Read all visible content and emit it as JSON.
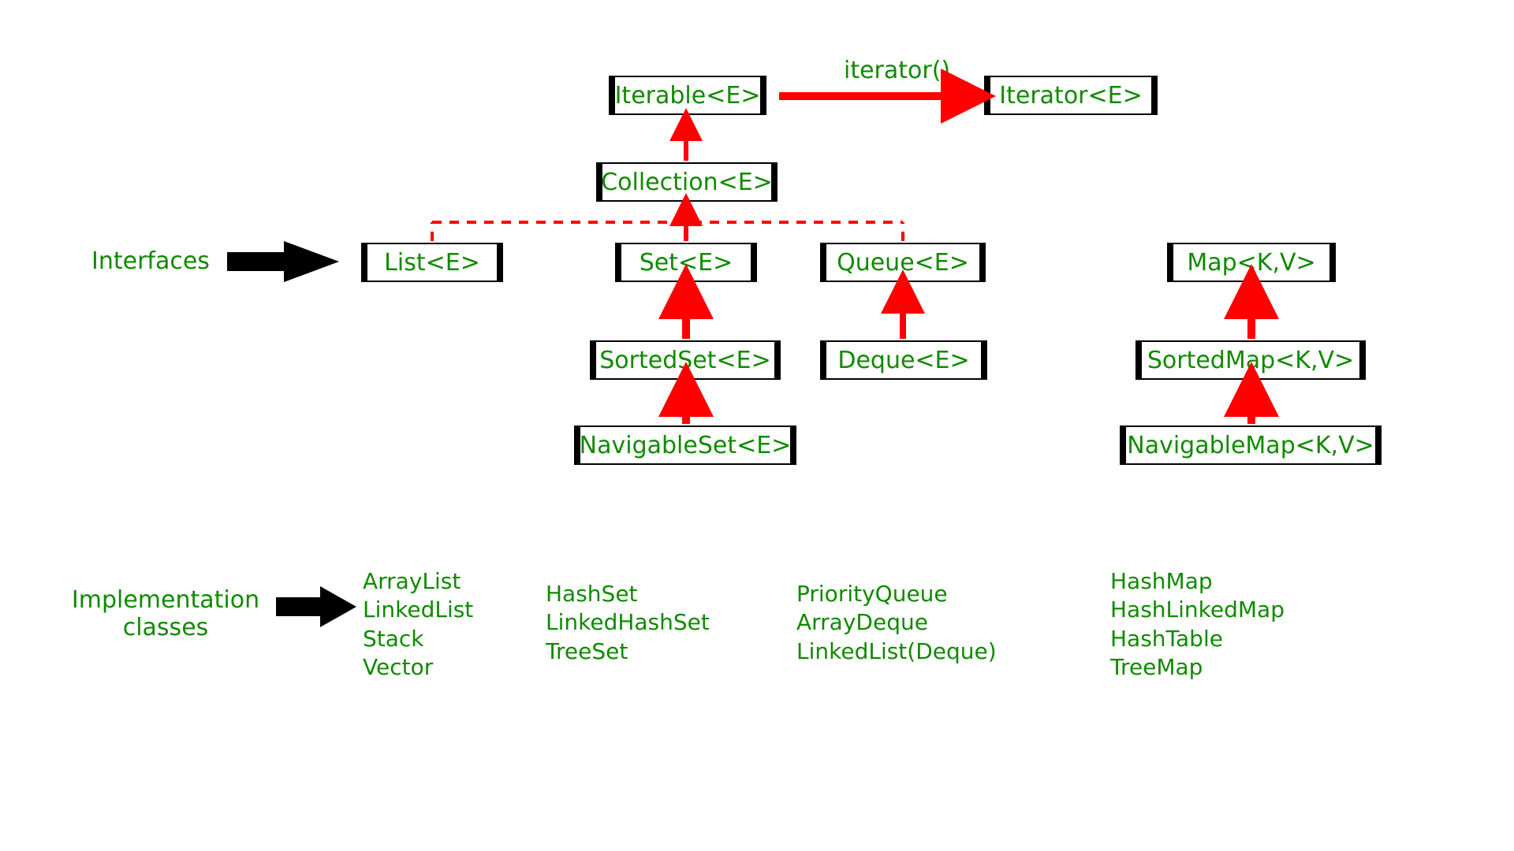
{
  "labels": {
    "interfaces": "Interfaces",
    "implHeader": "Implementation\nclasses",
    "iteratorMethod": "iterator()"
  },
  "boxes": {
    "iterable": "Iterable<E>",
    "iterator": "Iterator<E>",
    "collection": "Collection<E>",
    "list": "List<E>",
    "set": "Set<E>",
    "queue": "Queue<E>",
    "sortedSet": "SortedSet<E>",
    "deque": "Deque<E>",
    "navigableSet": "NavigableSet<E>",
    "map": "Map<K,V>",
    "sortedMap": "SortedMap<K,V>",
    "navigableMap": "NavigableMap<K,V>"
  },
  "impl": {
    "list": "ArrayList\nLinkedList\nStack\nVector",
    "set": "HashSet\nLinkedHashSet\nTreeSet",
    "queue": "PriorityQueue\nArrayDeque\nLinkedList(Deque)",
    "map": "HashMap\nHashLinkedMap\nHashTable\nTreeMap"
  }
}
